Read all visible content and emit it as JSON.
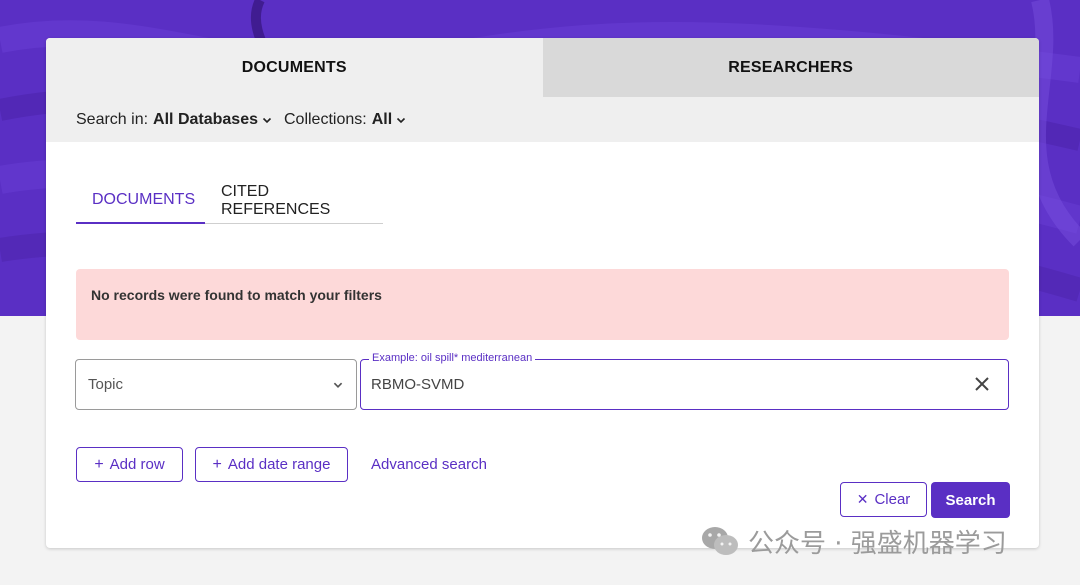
{
  "colors": {
    "accent": "#5a2fc4",
    "alert_bg": "#fdd9d9",
    "hero_bg": "#5a2fc4"
  },
  "tabs": {
    "documents": "DOCUMENTS",
    "researchers": "RESEARCHERS"
  },
  "filters": {
    "search_in_label": "Search in:",
    "search_in_value": "All Databases",
    "collections_label": "Collections:",
    "collections_value": "All"
  },
  "sub_tabs": {
    "documents": "DOCUMENTS",
    "cited_references": "CITED REFERENCES"
  },
  "alert": {
    "message": "No records were found to match your filters"
  },
  "search": {
    "field_value": "Topic",
    "input_label": "Example: oil spill* mediterranean",
    "input_value": "RBMO-SVMD"
  },
  "buttons": {
    "add_row": "Add row",
    "add_date_range": "Add date range",
    "advanced_search": "Advanced search",
    "clear": "Clear",
    "search": "Search"
  },
  "watermark": {
    "text": "公众号 · 强盛机器学习"
  }
}
